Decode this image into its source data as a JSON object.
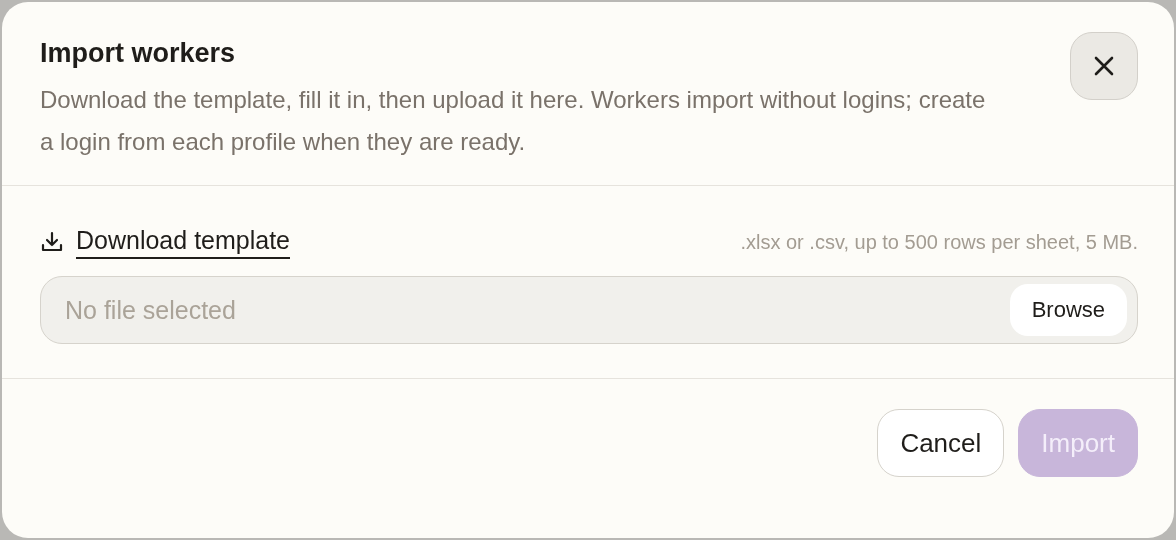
{
  "dialog": {
    "title": "Import workers",
    "description": "Download the template, fill it in, then upload it here. Workers import without logins; create a login from each profile when they are ready."
  },
  "template_link": {
    "label": "Download template"
  },
  "file_hint": ".xlsx or .csv, up to 500 rows per sheet, 5 MB.",
  "file_field": {
    "placeholder": "No file selected",
    "button": "Browse"
  },
  "buttons": [
    {
      "label": "Cancel",
      "kind": "secondary",
      "disabled": false
    },
    {
      "label": "Import",
      "kind": "primary",
      "disabled": true
    }
  ]
}
